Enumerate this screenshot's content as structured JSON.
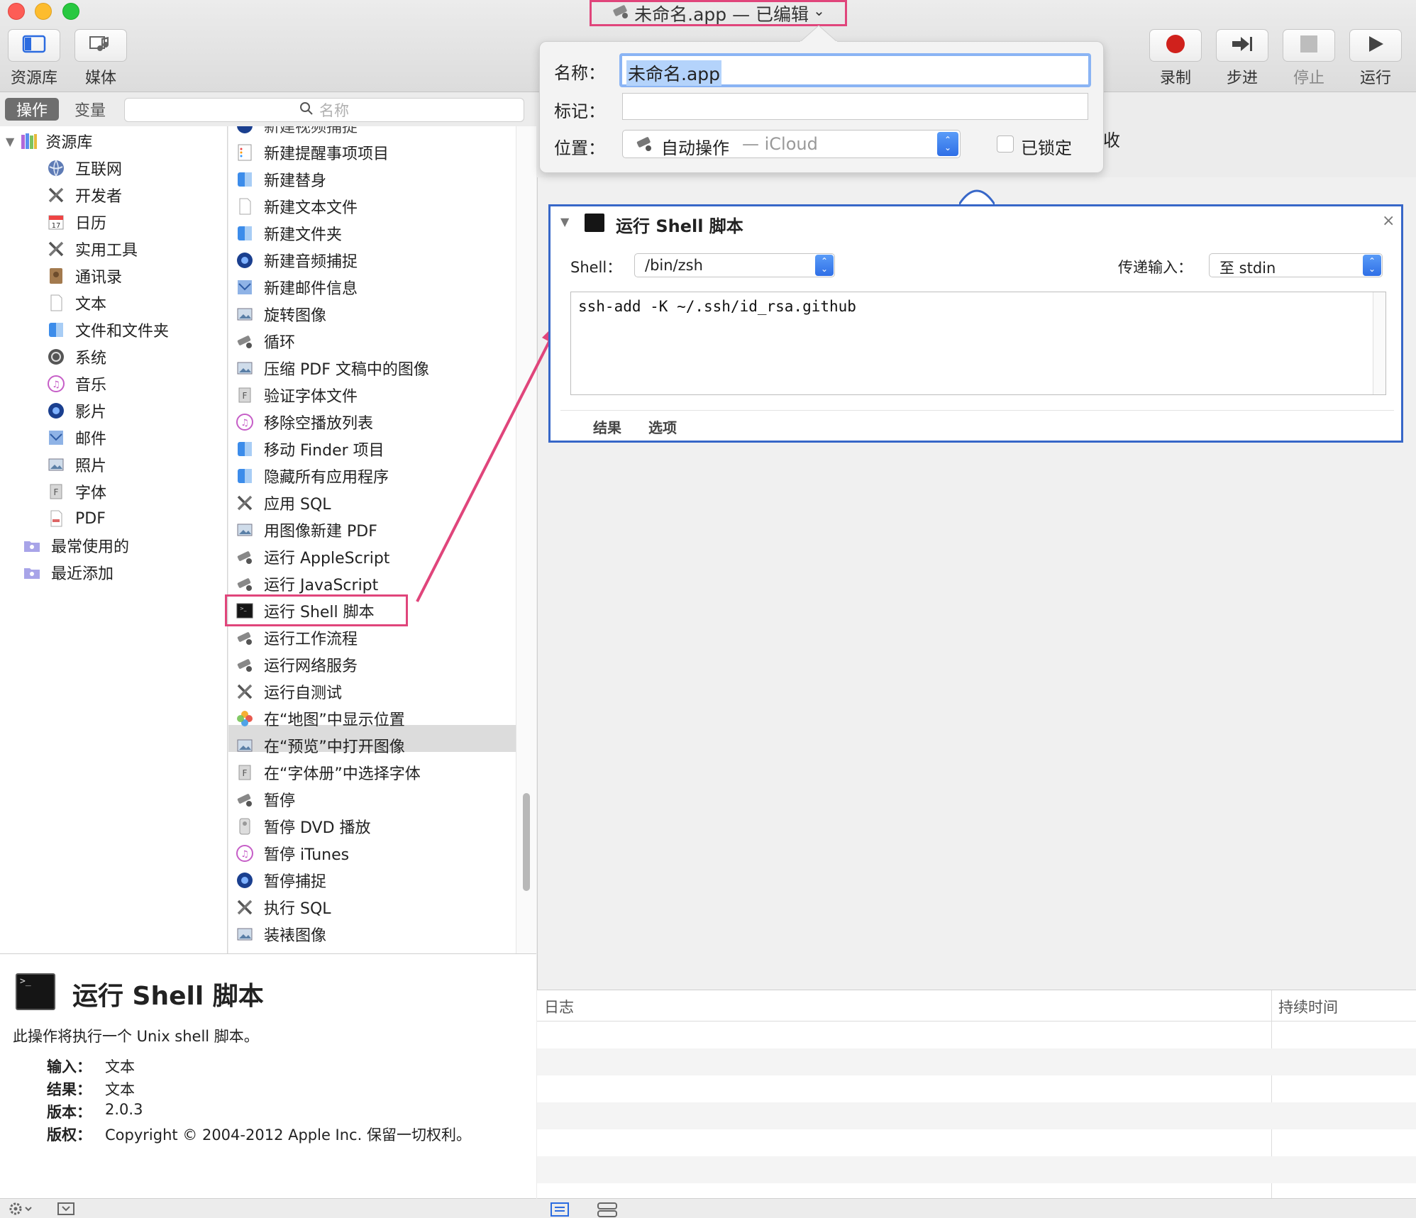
{
  "window": {
    "title": "未命名.app — 已编辑",
    "title_chevron": "⌄"
  },
  "toolbar": {
    "library_label": "资源库",
    "media_label": "媒体",
    "record_label": "录制",
    "step_label": "步进",
    "stop_label": "停止",
    "run_label": "运行"
  },
  "tabs": {
    "actions": "操作",
    "variables": "变量"
  },
  "search": {
    "placeholder": "名称"
  },
  "library": {
    "root": "资源库",
    "items": [
      {
        "label": "互联网",
        "icon": "globe-icon"
      },
      {
        "label": "开发者",
        "icon": "tools-icon"
      },
      {
        "label": "日历",
        "icon": "calendar-icon"
      },
      {
        "label": "实用工具",
        "icon": "tools-icon"
      },
      {
        "label": "通讯录",
        "icon": "contacts-icon"
      },
      {
        "label": "文本",
        "icon": "text-icon"
      },
      {
        "label": "文件和文件夹",
        "icon": "finder-icon"
      },
      {
        "label": "系统",
        "icon": "system-icon"
      },
      {
        "label": "音乐",
        "icon": "music-icon"
      },
      {
        "label": "影片",
        "icon": "quicktime-icon"
      },
      {
        "label": "邮件",
        "icon": "mail-icon"
      },
      {
        "label": "照片",
        "icon": "photo-icon"
      },
      {
        "label": "字体",
        "icon": "font-icon"
      },
      {
        "label": "PDF",
        "icon": "pdf-icon"
      }
    ],
    "smart": [
      {
        "label": "最常使用的",
        "icon": "smart-folder-icon"
      },
      {
        "label": "最近添加",
        "icon": "smart-folder-icon"
      }
    ]
  },
  "actions": {
    "partial_top": "新建视频捕捉",
    "items": [
      {
        "label": "新建提醒事项项目",
        "icon": "reminders-icon"
      },
      {
        "label": "新建替身",
        "icon": "finder-icon"
      },
      {
        "label": "新建文本文件",
        "icon": "text-icon"
      },
      {
        "label": "新建文件夹",
        "icon": "finder-icon"
      },
      {
        "label": "新建音频捕捉",
        "icon": "quicktime-icon"
      },
      {
        "label": "新建邮件信息",
        "icon": "mail-icon"
      },
      {
        "label": "旋转图像",
        "icon": "preview-icon"
      },
      {
        "label": "循环",
        "icon": "automator-icon"
      },
      {
        "label": "压缩 PDF 文稿中的图像",
        "icon": "preview-icon"
      },
      {
        "label": "验证字体文件",
        "icon": "font-icon"
      },
      {
        "label": "移除空播放列表",
        "icon": "music-icon"
      },
      {
        "label": "移动 Finder 项目",
        "icon": "finder-icon"
      },
      {
        "label": "隐藏所有应用程序",
        "icon": "finder-icon"
      },
      {
        "label": "应用 SQL",
        "icon": "tools-icon"
      },
      {
        "label": "用图像新建 PDF",
        "icon": "preview-icon"
      },
      {
        "label": "运行 AppleScript",
        "icon": "automator-icon"
      },
      {
        "label": "运行 JavaScript",
        "icon": "automator-icon"
      },
      {
        "label": "运行 Shell 脚本",
        "icon": "terminal-icon"
      },
      {
        "label": "运行工作流程",
        "icon": "automator-icon"
      },
      {
        "label": "运行网络服务",
        "icon": "automator-icon"
      },
      {
        "label": "运行自测试",
        "icon": "tools-icon"
      },
      {
        "label": "在“地图”中显示位置",
        "icon": "photos-icon"
      },
      {
        "label": "在“预览”中打开图像",
        "icon": "preview-icon"
      },
      {
        "label": "在“字体册”中选择字体",
        "icon": "font-icon"
      },
      {
        "label": "暂停",
        "icon": "automator-icon"
      },
      {
        "label": "暂停 DVD 播放",
        "icon": "dvd-icon"
      },
      {
        "label": "暂停 iTunes",
        "icon": "music-icon"
      },
      {
        "label": "暂停捕捉",
        "icon": "quicktime-icon"
      },
      {
        "label": "执行 SQL",
        "icon": "tools-icon"
      },
      {
        "label": "装裱图像",
        "icon": "preview-icon"
      }
    ]
  },
  "description": {
    "title": "运行 Shell 脚本",
    "summary": "此操作将执行一个 Unix shell 脚本。",
    "input_label": "输入：",
    "input_value": "文本",
    "result_label": "结果：",
    "result_value": "文本",
    "version_label": "版本：",
    "version_value": "2.0.3",
    "copyright_label": "版权：",
    "copyright_value": "Copyright © 2004-2012 Apple Inc.  保留一切权利。"
  },
  "popover": {
    "name_label": "名称：",
    "name_value": "未命名.app",
    "tags_label": "标记：",
    "tags_value": "",
    "location_label": "位置：",
    "location_value": "自动操作",
    "location_suffix": "— iCloud",
    "locked_label": "已锁定"
  },
  "strip": {
    "partial_text": "收"
  },
  "shell_action": {
    "title": "运行 Shell 脚本",
    "close": "×",
    "shell_label": "Shell：",
    "shell_value": "/bin/zsh",
    "pass_input_label": "传递输入：",
    "pass_input_value": "至 stdin",
    "script": "ssh-add -K ~/.ssh/id_rsa.github",
    "tab_results": "结果",
    "tab_options": "选项"
  },
  "log": {
    "col_log": "日志",
    "col_duration": "持续时间"
  },
  "colors": {
    "highlight_pink": "#e0457b",
    "action_border": "#3767c8",
    "record_red": "#d0211c",
    "text_selection": "#b4d3fb"
  }
}
